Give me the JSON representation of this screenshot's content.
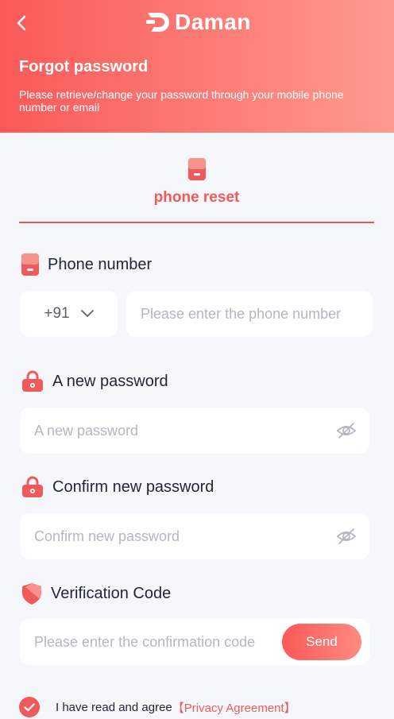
{
  "header": {
    "brand": "Daman",
    "title": "Forgot password",
    "description": "Please retrieve/change your password through your mobile phone number or email"
  },
  "tab": {
    "label": "phone reset"
  },
  "phone": {
    "label": "Phone number",
    "country_code": "+91",
    "placeholder": "Please enter the phone number"
  },
  "new_password": {
    "label": "A new password",
    "placeholder": "A new password"
  },
  "confirm_password": {
    "label": "Confirm new password",
    "placeholder": "Confirm new password"
  },
  "verification": {
    "label": "Verification Code",
    "placeholder": "Please enter the confirmation code",
    "send_label": "Send"
  },
  "agreement": {
    "text": "I have read and agree",
    "link": "【Privacy Agreement】",
    "checked": true
  },
  "colors": {
    "accent": "#f05a5a",
    "header_start": "#f95959",
    "header_end": "#ff9a8e",
    "background": "#f6f7fb"
  }
}
